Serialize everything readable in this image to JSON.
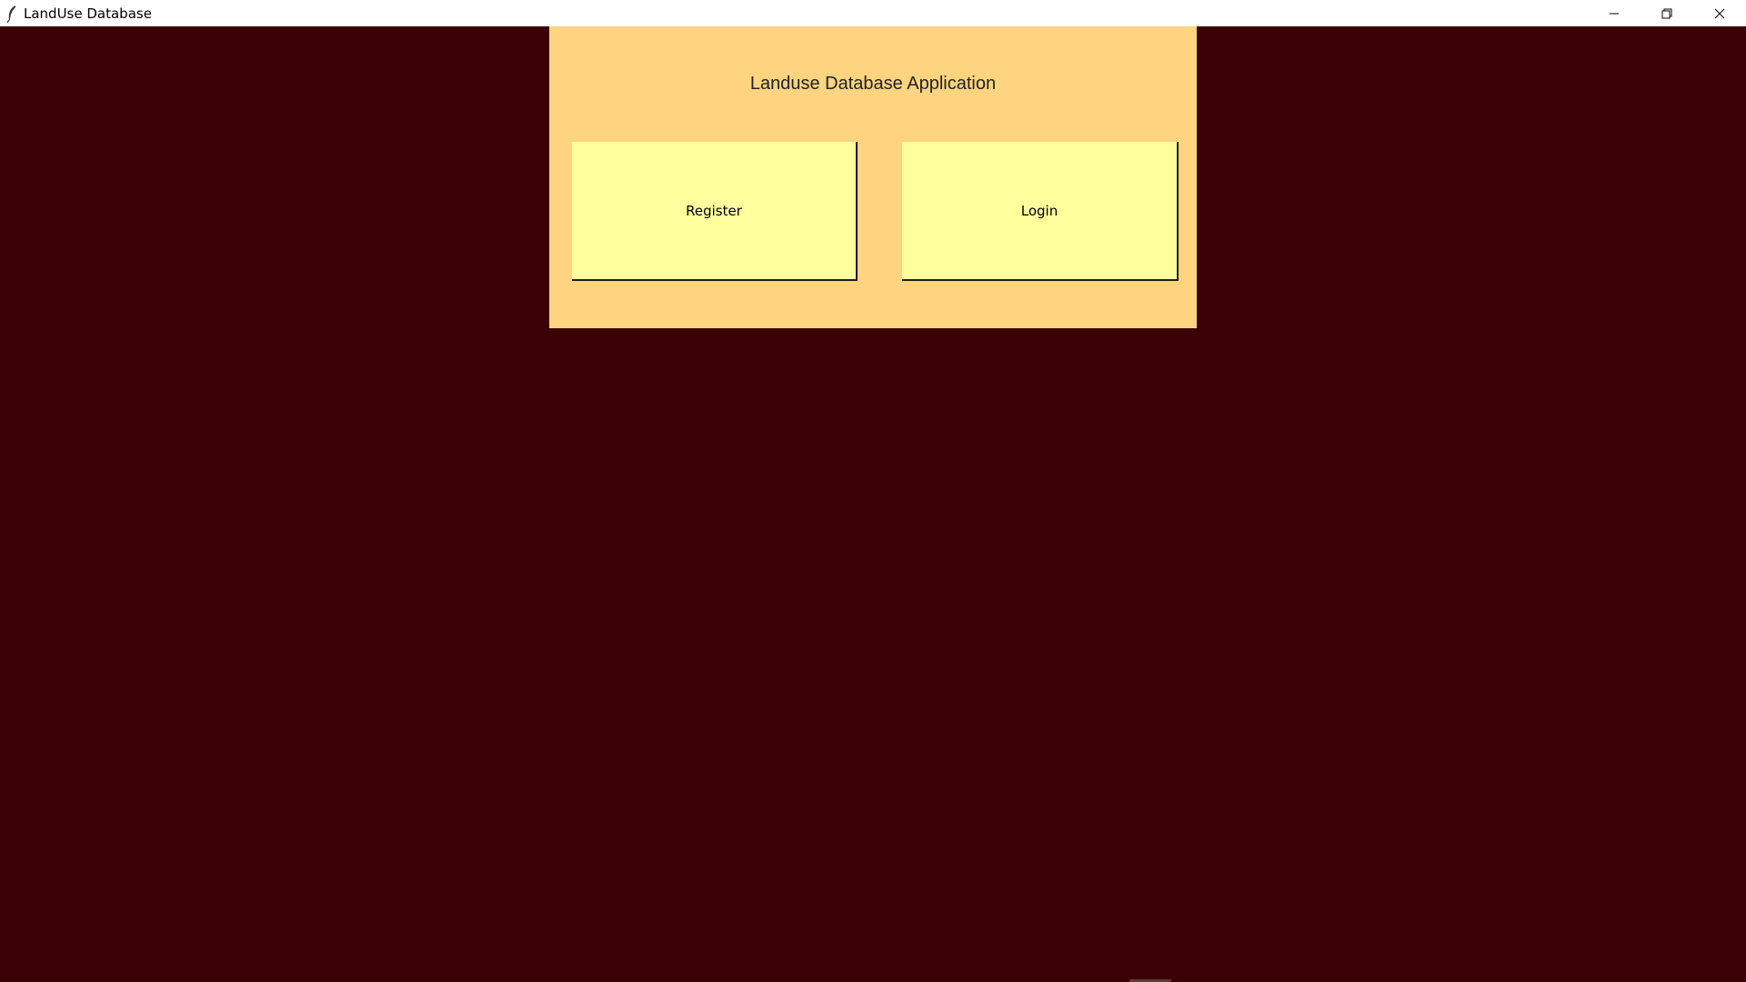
{
  "window": {
    "title": "LandUse Database",
    "icon": "feather-icon",
    "controls": [
      "minimize-icon",
      "restore-icon",
      "close-icon"
    ]
  },
  "colors": {
    "background": "#3a0003",
    "panel": "#fed480",
    "button": "#ffff9e"
  },
  "main": {
    "heading": "Landuse Database Application",
    "register_label": "Register",
    "login_label": "Login"
  }
}
